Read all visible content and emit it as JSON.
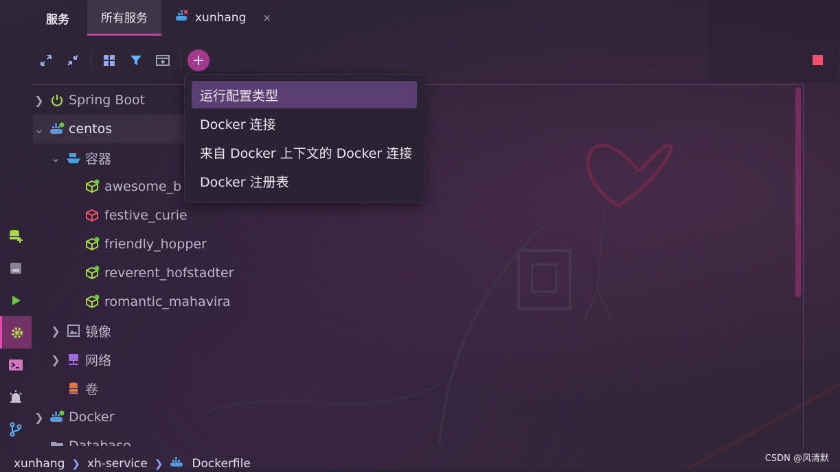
{
  "tabs": {
    "services": "服务",
    "all_services": "所有服务",
    "project": "xunhang",
    "close": "×"
  },
  "toolbar": {
    "add": "+",
    "icons": [
      "expand-icon",
      "collapse-icon",
      "group-icon",
      "filter-icon",
      "new-tab-icon",
      "add-icon"
    ]
  },
  "tree": {
    "spring_boot": "Spring Boot",
    "centos": "centos",
    "containers": "容器",
    "container_items": [
      "awesome_b",
      "festive_curie",
      "friendly_hopper",
      "reverent_hofstadter",
      "romantic_mahavira"
    ],
    "images": "镜像",
    "networks": "网络",
    "volumes": "卷",
    "docker": "Docker",
    "database": "Database"
  },
  "menu": {
    "items": [
      "运行配置类型",
      "Docker 连接",
      "来自 Docker 上下文的 Docker 连接",
      "Docker 注册表"
    ]
  },
  "breadcrumb": {
    "items": [
      "xunhang",
      "xh-service",
      "Dockerfile"
    ]
  },
  "watermark": "CSDN @风清默",
  "colors": {
    "accent": "#c83fa0",
    "menu_highlight": "#5a3f73",
    "running": "#6cc644",
    "stopped": "#f0506a",
    "docker_blue": "#4d9de0"
  }
}
